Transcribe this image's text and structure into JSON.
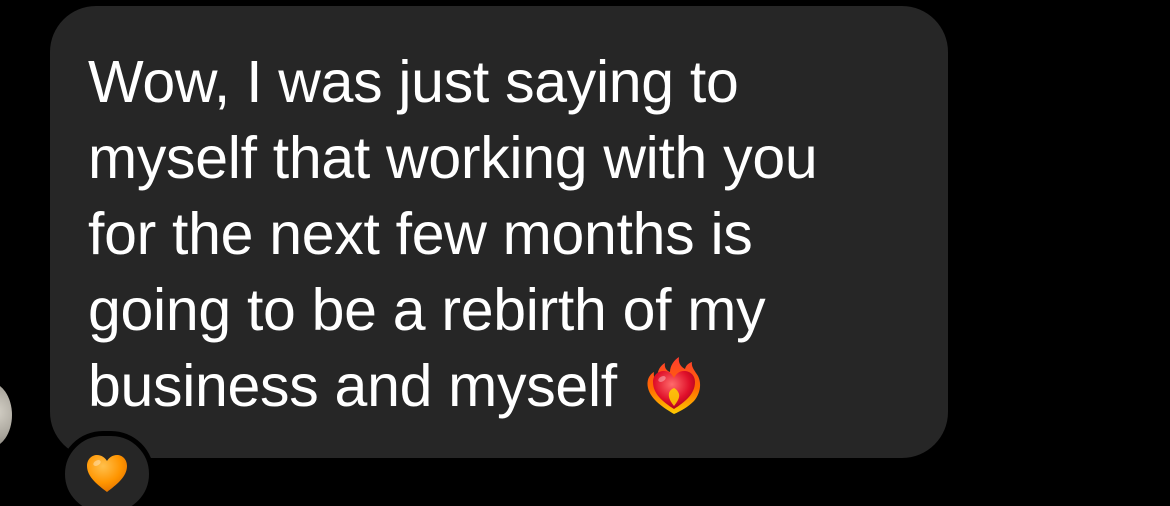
{
  "message": {
    "lines": [
      "Wow, I was just saying to",
      "myself that working with you",
      "for the next few months is",
      "going to be a rebirth of my",
      "business and myself"
    ],
    "trailing_emoji": "heart-on-fire-icon"
  },
  "reaction": {
    "emoji": "orange-heart-icon"
  },
  "colors": {
    "background": "#000000",
    "bubble": "#262626",
    "text": "#ffffff",
    "reaction_heart": "#ff9500"
  }
}
